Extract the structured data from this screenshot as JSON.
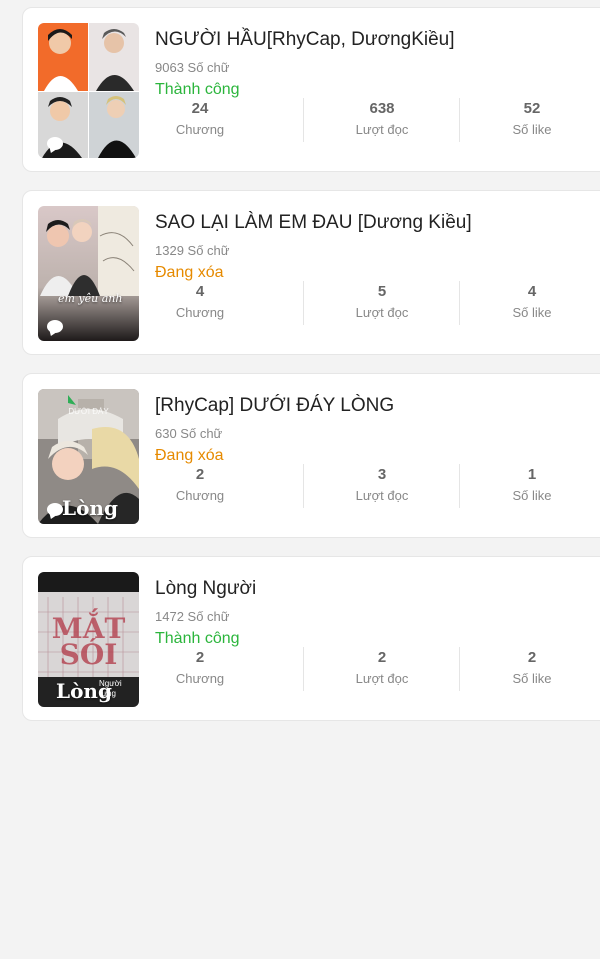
{
  "colors": {
    "success": "#2bb53c",
    "deleting": "#e68a00"
  },
  "stories": [
    {
      "title": "NGƯỜI HẦU[RhyCap, DươngKiều]",
      "words": "9063 Số chữ",
      "status": "Thành công",
      "status_type": "success",
      "stats": [
        {
          "value": "24",
          "label": "Chương"
        },
        {
          "value": "638",
          "label": "Lượt đọc"
        },
        {
          "value": "52",
          "label": "Số like"
        }
      ]
    },
    {
      "title": "SAO LẠI LÀM EM ĐAU [Dương Kiều]",
      "words": "1329 Số chữ",
      "status": "Đang xóa",
      "status_type": "deleting",
      "cover_text": "em yêu anh",
      "stats": [
        {
          "value": "4",
          "label": "Chương"
        },
        {
          "value": "5",
          "label": "Lượt đọc"
        },
        {
          "value": "4",
          "label": "Số like"
        }
      ]
    },
    {
      "title": "[RhyCap] DƯỚI ĐÁY LÒNG",
      "words": "630 Số chữ",
      "status": "Đang xóa",
      "status_type": "deleting",
      "cover_text": "Lòng",
      "cover_top": "DƯỚI ĐÁY",
      "stats": [
        {
          "value": "2",
          "label": "Chương"
        },
        {
          "value": "3",
          "label": "Lượt đọc"
        },
        {
          "value": "1",
          "label": "Số like"
        }
      ]
    },
    {
      "title": "Lòng Người",
      "words": "1472 Số chữ",
      "status": "Thành công",
      "status_type": "success",
      "cover_text": "Lòng",
      "cover_sub": "Người rưng",
      "cover_big": "MẮT SÓI",
      "stats": [
        {
          "value": "2",
          "label": "Chương"
        },
        {
          "value": "2",
          "label": "Lượt đọc"
        },
        {
          "value": "2",
          "label": "Số like"
        }
      ]
    }
  ]
}
